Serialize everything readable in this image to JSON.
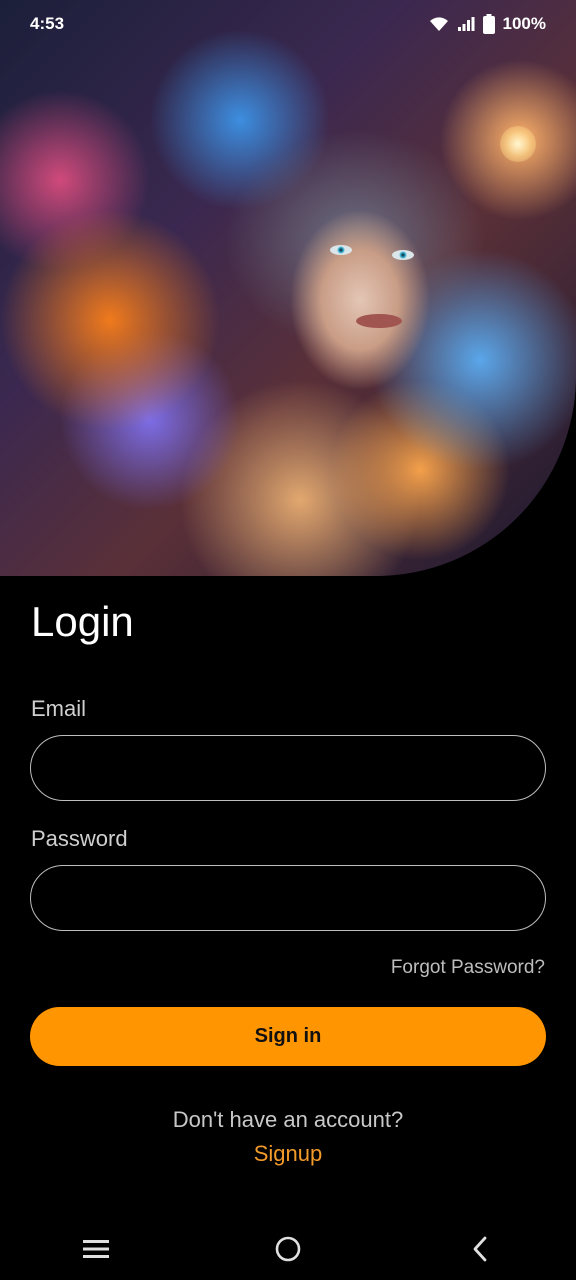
{
  "status_bar": {
    "time": "4:53",
    "battery_percent": "100%",
    "icons": [
      "wifi-icon",
      "signal-icon",
      "battery-icon"
    ]
  },
  "hero": {
    "icon": "hero-illustration"
  },
  "login": {
    "title": "Login",
    "email_label": "Email",
    "email_value": "",
    "password_label": "Password",
    "password_value": "",
    "forgot_password": "Forgot Password?",
    "sign_in": "Sign in",
    "no_account": "Don't have an account?",
    "signup": "Signup"
  },
  "colors": {
    "accent": "#ff9500",
    "signup_link": "#f29a2a",
    "background": "#000000"
  },
  "nav": {
    "icons": [
      "menu-icon",
      "home-icon",
      "back-icon"
    ]
  }
}
